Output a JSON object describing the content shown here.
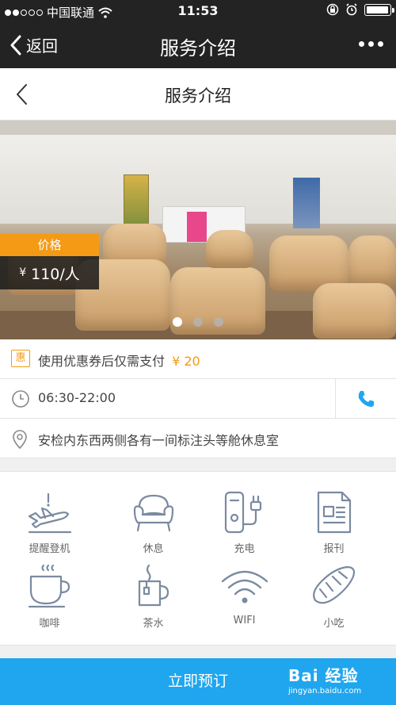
{
  "status_bar": {
    "carrier": "中国联通",
    "time": "11:53"
  },
  "nav_bar": {
    "back_label": "返回",
    "title": "服务介绍"
  },
  "page_header": {
    "title": "服务介绍"
  },
  "hero": {
    "price_label": "价格",
    "currency": "¥",
    "price_value": "110/人",
    "slide_count": 3,
    "active_slide": 1
  },
  "coupon": {
    "badge": "惠",
    "text": "使用优惠券后仅需支付",
    "amount": "¥ 20"
  },
  "hours": {
    "text": "06:30-22:00"
  },
  "location": {
    "text": "安检内东西两侧各有一间标注头等舱休息室"
  },
  "facilities": [
    {
      "label": "提醒登机",
      "icon": "plane-icon"
    },
    {
      "label": "休息",
      "icon": "sofa-icon"
    },
    {
      "label": "充电",
      "icon": "charger-icon"
    },
    {
      "label": "报刊",
      "icon": "newspaper-icon"
    },
    {
      "label": "咖啡",
      "icon": "coffee-icon"
    },
    {
      "label": "茶水",
      "icon": "tea-icon"
    },
    {
      "label": "WIFI",
      "icon": "wifi-icon"
    },
    {
      "label": "小吃",
      "icon": "bread-icon"
    }
  ],
  "bottom_button": {
    "label": "立即预订"
  },
  "watermark": {
    "line1": "Bai 经验",
    "line2": "jingyan.baidu.com"
  },
  "colors": {
    "accent": "#f59a14",
    "primary": "#20a6ee",
    "icon": "#7a8aa0"
  }
}
